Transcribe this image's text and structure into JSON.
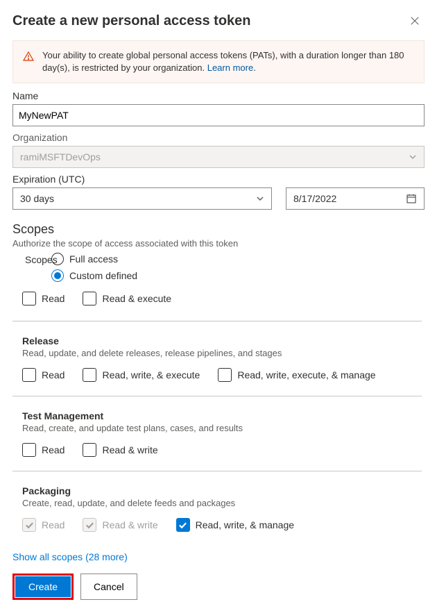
{
  "header": {
    "title": "Create a new personal access token"
  },
  "banner": {
    "text_before": "Your ability to create global personal access tokens (PATs), with a duration longer than 180 day(s), is restricted by your organization. ",
    "link_text": "Learn more",
    "link_suffix": "."
  },
  "fields": {
    "name_label": "Name",
    "name_value": "MyNewPAT",
    "org_label": "Organization",
    "org_value": "ramiMSFTDevOps",
    "exp_label": "Expiration (UTC)",
    "exp_select": "30 days",
    "exp_date": "8/17/2022"
  },
  "scopes_header": {
    "title": "Scopes",
    "subtitle": "Authorize the scope of access associated with this token",
    "label": "Scopes",
    "radio_full": "Full access",
    "radio_custom": "Custom defined"
  },
  "scope_blocks": [
    {
      "title": "",
      "desc": "",
      "perms": [
        {
          "label": "Read",
          "checked": false,
          "disabled": false
        },
        {
          "label": "Read & execute",
          "checked": false,
          "disabled": false
        }
      ],
      "partial_top": true
    },
    {
      "title": "Release",
      "desc": "Read, update, and delete releases, release pipelines, and stages",
      "perms": [
        {
          "label": "Read",
          "checked": false,
          "disabled": false
        },
        {
          "label": "Read, write, & execute",
          "checked": false,
          "disabled": false
        },
        {
          "label": "Read, write, execute, & manage",
          "checked": false,
          "disabled": false
        }
      ]
    },
    {
      "title": "Test Management",
      "desc": "Read, create, and update test plans, cases, and results",
      "perms": [
        {
          "label": "Read",
          "checked": false,
          "disabled": false
        },
        {
          "label": "Read & write",
          "checked": false,
          "disabled": false
        }
      ]
    },
    {
      "title": "Packaging",
      "desc": "Create, read, update, and delete feeds and packages",
      "perms": [
        {
          "label": "Read",
          "checked": true,
          "disabled": true
        },
        {
          "label": "Read & write",
          "checked": true,
          "disabled": true
        },
        {
          "label": "Read, write, & manage",
          "checked": true,
          "disabled": false
        }
      ]
    }
  ],
  "footer": {
    "show_scopes_text": "Show all scopes",
    "show_scopes_count": "(28 more)",
    "create": "Create",
    "cancel": "Cancel"
  }
}
